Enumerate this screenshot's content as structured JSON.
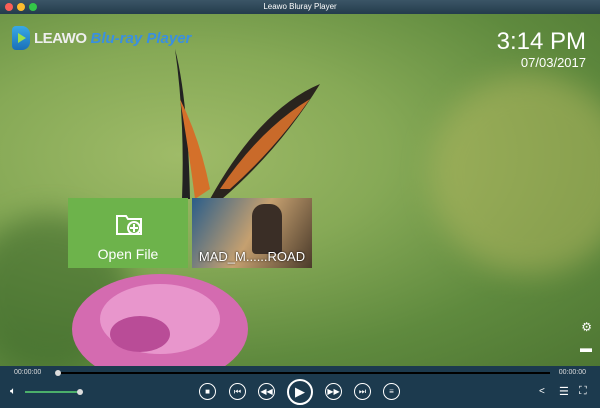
{
  "window": {
    "title": "Leawo Bluray Player"
  },
  "logo": {
    "word1": "LEAWO",
    "word2": "Blu-ray Player"
  },
  "clock": {
    "time": "3:14 PM",
    "date": "07/03/2017"
  },
  "tiles": {
    "open_file": "Open File",
    "disc": "MAD_M......ROAD"
  },
  "player": {
    "elapsed": "00:00:00",
    "total": "00:00:00",
    "progress": 0,
    "volume": 0.85
  },
  "colors": {
    "accent": "#6db34b",
    "control_bar": "#1c3a4e"
  }
}
